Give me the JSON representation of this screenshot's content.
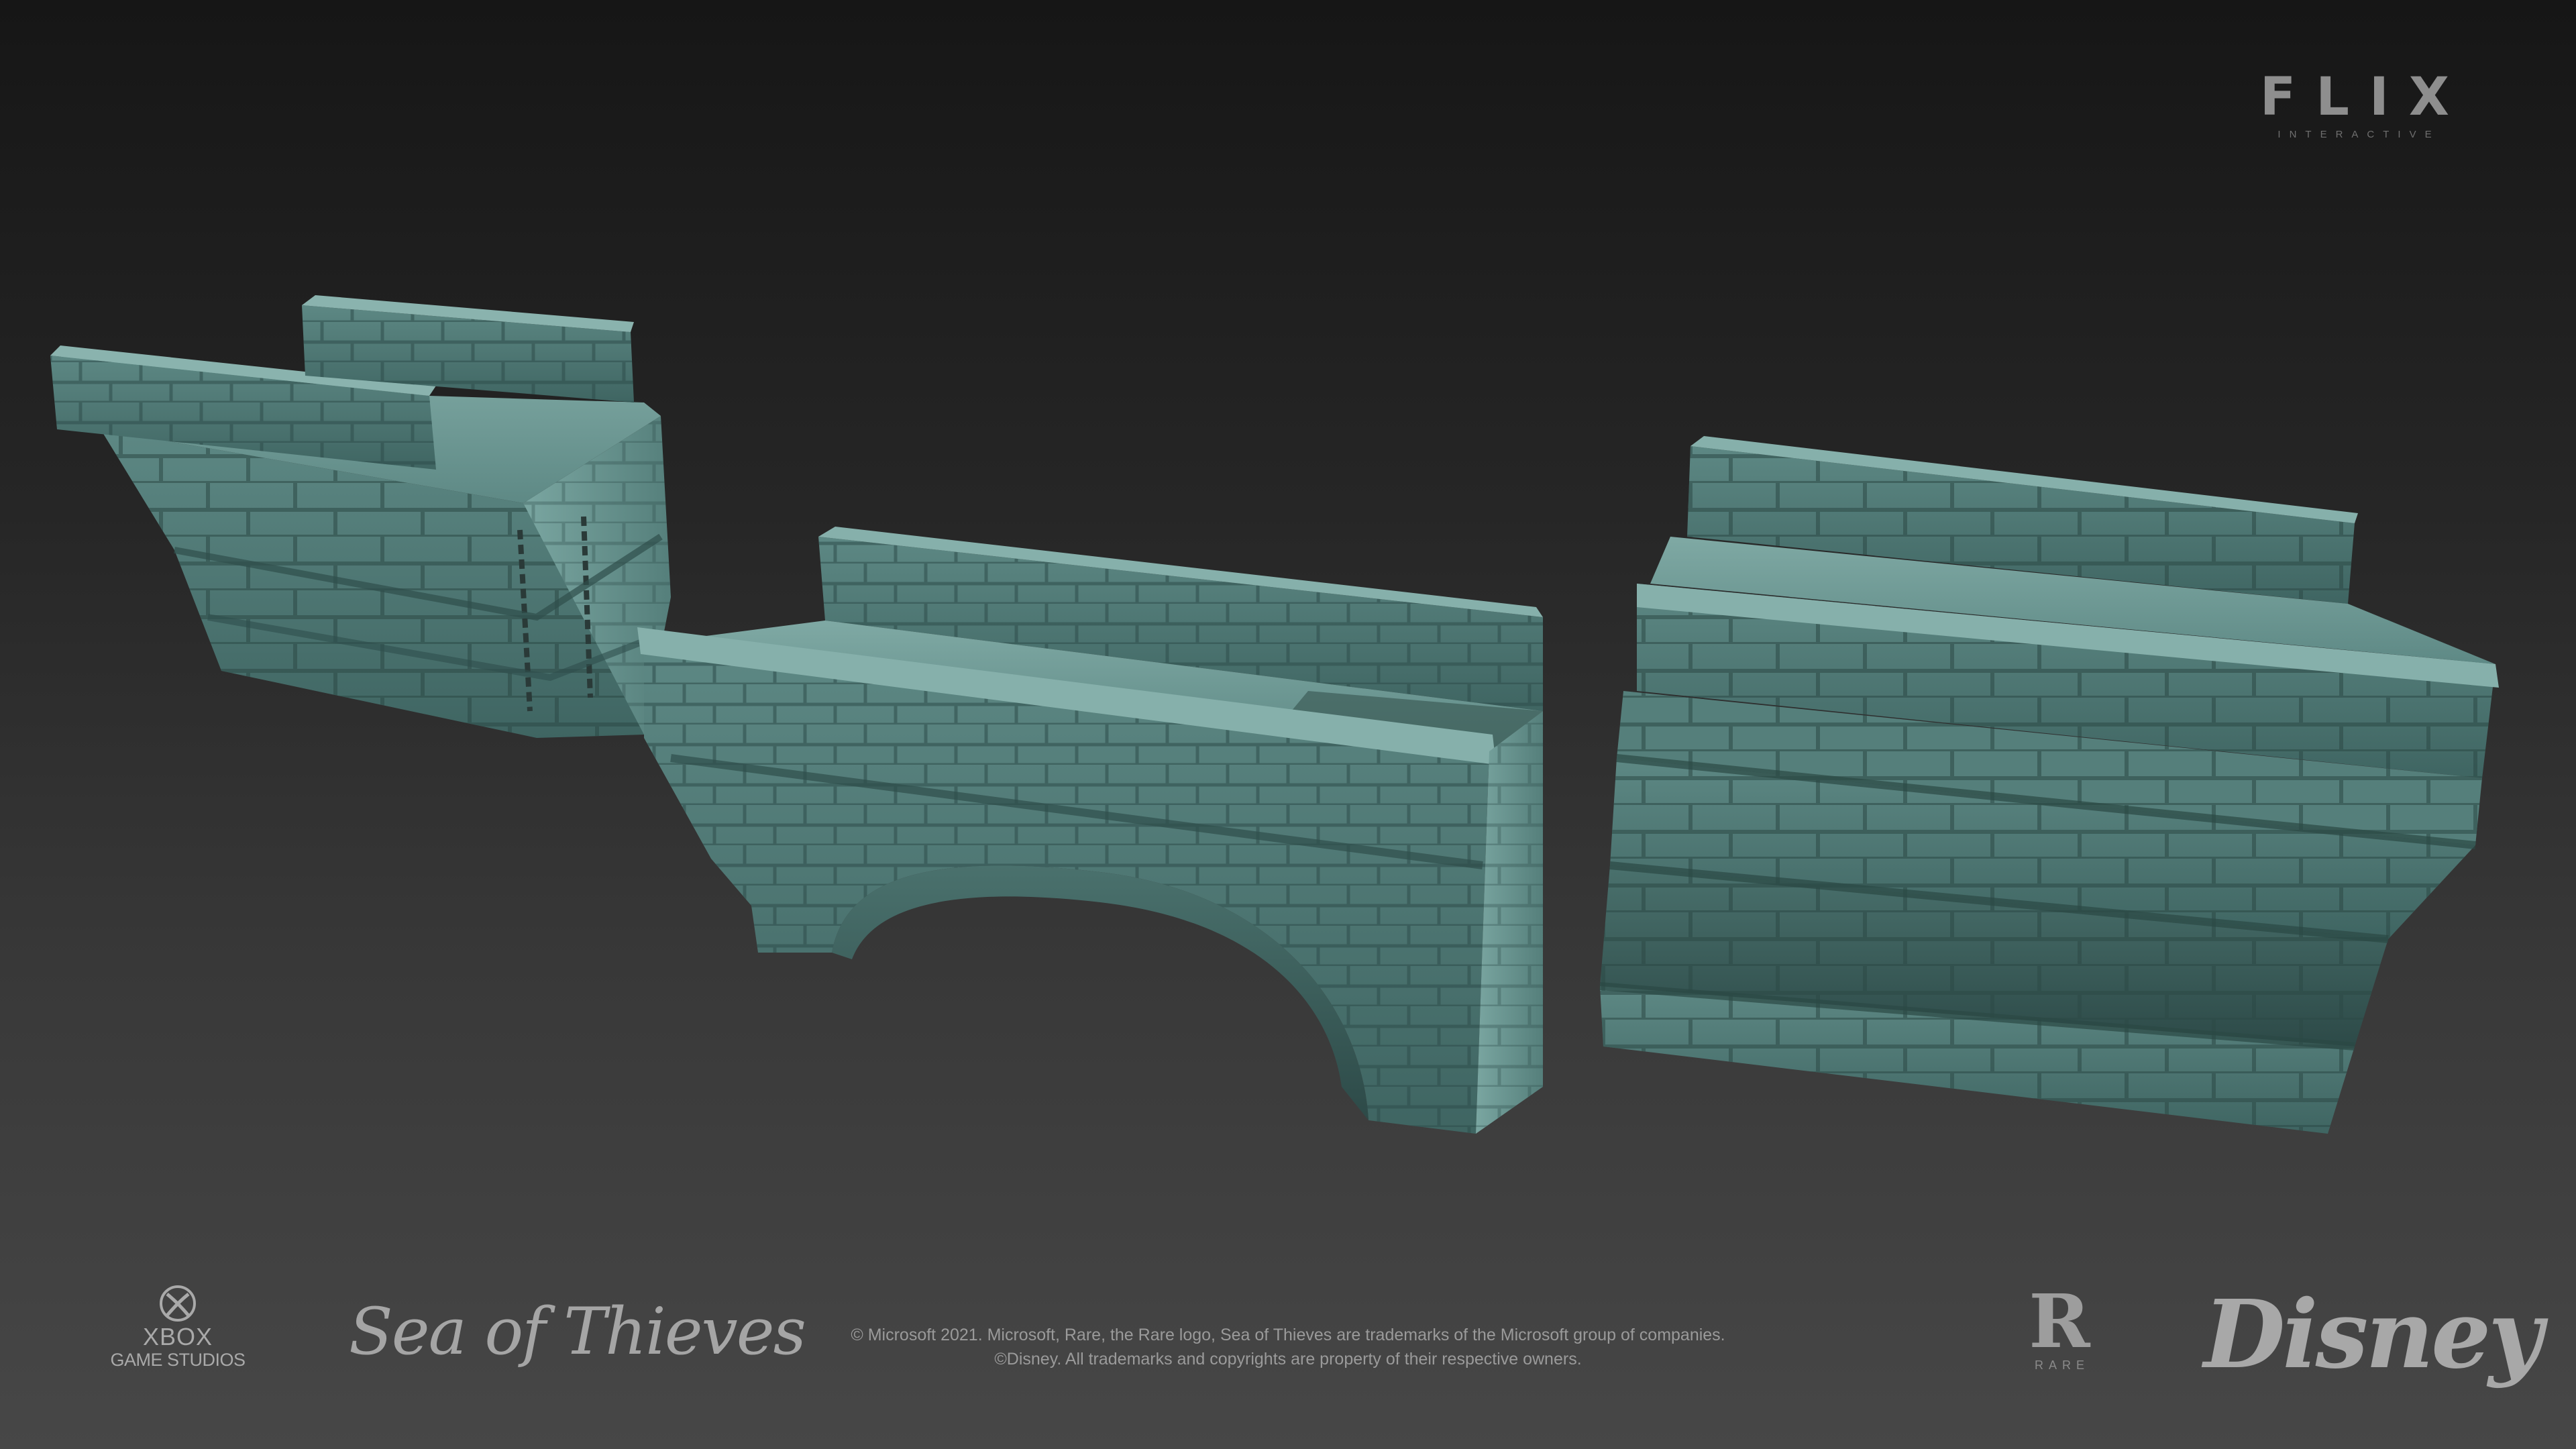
{
  "brand": {
    "studio_logo_text": "FLIX",
    "studio_logo_subtext": "INTERACTIVE"
  },
  "footer": {
    "xbox_line1": "XBOX",
    "xbox_line2": "GAME STUDIOS",
    "game_logo_text": "Sea of Thieves",
    "legal_line1": "© Microsoft 2021. Microsoft, Rare, the Rare logo, Sea of Thieves are trademarks of the Microsoft group of companies.",
    "legal_line2": "©Disney. All trademarks and copyrights are property of their respective owners.",
    "rare_logo_letter": "R",
    "rare_logo_subtext": "RARE",
    "disney_logo_text": "Disney"
  },
  "colors": {
    "stone_light": "#6f9b96",
    "stone_mid": "#4f7a76",
    "stone_dark": "#2f4f4c",
    "background_top": "#161616",
    "background_bottom": "#474747"
  }
}
